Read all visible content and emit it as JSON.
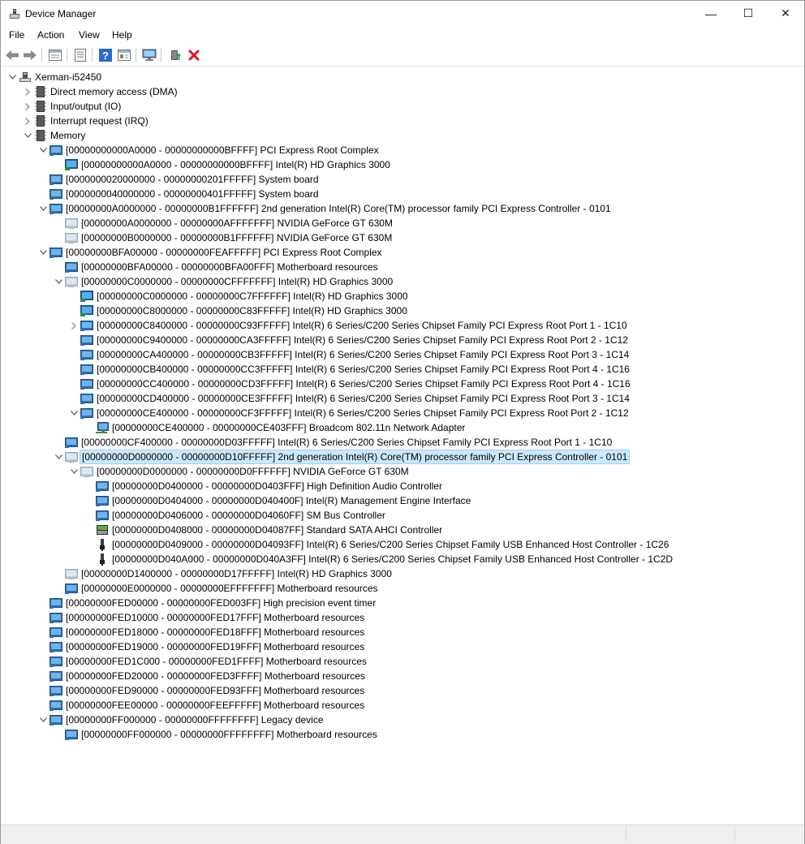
{
  "window": {
    "title": "Device Manager",
    "controls": {
      "minimize": "—",
      "maximize": "☐",
      "close": "✕"
    }
  },
  "menu": {
    "items": [
      "File",
      "Action",
      "View",
      "Help"
    ]
  },
  "toolbar": {
    "buttons": [
      "back-icon",
      "forward-icon",
      "properties-view-icon",
      "list-view-icon",
      "help-icon",
      "details-view-icon",
      "scan-hardware-icon",
      "update-driver-icon",
      "uninstall-icon"
    ]
  },
  "tree": {
    "rows": [
      {
        "depth": 0,
        "expander": "open",
        "icon": "computer-icon",
        "label": "Xerman-i52450"
      },
      {
        "depth": 1,
        "expander": "closed",
        "icon": "chip-icon",
        "label": "Direct memory access (DMA)"
      },
      {
        "depth": 1,
        "expander": "closed",
        "icon": "chip-icon",
        "label": "Input/output (IO)"
      },
      {
        "depth": 1,
        "expander": "closed",
        "icon": "chip-icon",
        "label": "Interrupt request (IRQ)"
      },
      {
        "depth": 1,
        "expander": "open",
        "icon": "chip-icon",
        "label": "Memory"
      },
      {
        "depth": 2,
        "expander": "open",
        "icon": "device-icon",
        "label": "[00000000000A0000 - 00000000000BFFFF]  PCI Express Root Complex"
      },
      {
        "depth": 3,
        "expander": "",
        "icon": "display-icon",
        "label": "[00000000000A0000 - 00000000000BFFFF]  Intel(R) HD Graphics 3000"
      },
      {
        "depth": 2,
        "expander": "",
        "icon": "device-icon",
        "label": "[0000000020000000 - 00000000201FFFFF]  System board"
      },
      {
        "depth": 2,
        "expander": "",
        "icon": "device-icon",
        "label": "[0000000040000000 - 00000000401FFFFF]  System board"
      },
      {
        "depth": 2,
        "expander": "open",
        "icon": "device-icon",
        "label": "[00000000A0000000 - 00000000B1FFFFFF]  2nd generation Intel(R) Core(TM) processor family PCI Express Controller - 0101"
      },
      {
        "depth": 3,
        "expander": "",
        "icon": "display-dim-icon",
        "label": "[00000000A0000000 - 00000000AFFFFFFF]  NVIDIA GeForce GT 630M"
      },
      {
        "depth": 3,
        "expander": "",
        "icon": "display-dim-icon",
        "label": "[00000000B0000000 - 00000000B1FFFFFF]  NVIDIA GeForce GT 630M"
      },
      {
        "depth": 2,
        "expander": "open",
        "icon": "device-icon",
        "label": "[00000000BFA00000 - 00000000FEAFFFFF]  PCI Express Root Complex"
      },
      {
        "depth": 3,
        "expander": "",
        "icon": "device-icon",
        "label": "[00000000BFA00000 - 00000000BFA00FFF]  Motherboard resources"
      },
      {
        "depth": 3,
        "expander": "open",
        "icon": "display-dim-icon",
        "label": "[00000000C0000000 - 00000000CFFFFFFF]  Intel(R) HD Graphics 3000"
      },
      {
        "depth": 4,
        "expander": "",
        "icon": "display-icon",
        "label": "[00000000C0000000 - 00000000C7FFFFFF]  Intel(R) HD Graphics 3000"
      },
      {
        "depth": 4,
        "expander": "",
        "icon": "display-icon",
        "label": "[00000000C8000000 - 00000000C83FFFFF]  Intel(R) HD Graphics 3000"
      },
      {
        "depth": 4,
        "expander": "closed",
        "icon": "device-icon",
        "label": "[00000000C8400000 - 00000000C93FFFFF]  Intel(R) 6 Series/C200 Series Chipset Family PCI Express Root Port 1 - 1C10"
      },
      {
        "depth": 4,
        "expander": "",
        "icon": "device-icon",
        "label": "[00000000C9400000 - 00000000CA3FFFFF]  Intel(R) 6 Series/C200 Series Chipset Family PCI Express Root Port 2 - 1C12"
      },
      {
        "depth": 4,
        "expander": "",
        "icon": "device-icon",
        "label": "[00000000CA400000 - 00000000CB3FFFFF]  Intel(R) 6 Series/C200 Series Chipset Family PCI Express Root Port 3 - 1C14"
      },
      {
        "depth": 4,
        "expander": "",
        "icon": "device-icon",
        "label": "[00000000CB400000 - 00000000CC3FFFFF]  Intel(R) 6 Series/C200 Series Chipset Family PCI Express Root Port 4 - 1C16"
      },
      {
        "depth": 4,
        "expander": "",
        "icon": "device-icon",
        "label": "[00000000CC400000 - 00000000CD3FFFFF]  Intel(R) 6 Series/C200 Series Chipset Family PCI Express Root Port 4 - 1C16"
      },
      {
        "depth": 4,
        "expander": "",
        "icon": "device-icon",
        "label": "[00000000CD400000 - 00000000CE3FFFFF]  Intel(R) 6 Series/C200 Series Chipset Family PCI Express Root Port 3 - 1C14"
      },
      {
        "depth": 4,
        "expander": "open",
        "icon": "device-icon",
        "label": "[00000000CE400000 - 00000000CF3FFFFF]  Intel(R) 6 Series/C200 Series Chipset Family PCI Express Root Port 2 - 1C12"
      },
      {
        "depth": 5,
        "expander": "",
        "icon": "network-icon",
        "label": "[00000000CE400000 - 00000000CE403FFF]  Broadcom 802.11n Network Adapter"
      },
      {
        "depth": 3,
        "expander": "",
        "icon": "device-icon",
        "label": "[00000000CF400000 - 00000000D03FFFFF]  Intel(R) 6 Series/C200 Series Chipset Family PCI Express Root Port 1 - 1C10"
      },
      {
        "depth": 3,
        "expander": "open",
        "icon": "display-dim-icon",
        "label": "[00000000D0000000 - 00000000D10FFFFF]  2nd generation Intel(R) Core(TM) processor family PCI Express Controller - 0101",
        "selected": true
      },
      {
        "depth": 4,
        "expander": "open",
        "icon": "display-dim-icon",
        "label": "[00000000D0000000 - 00000000D0FFFFFF]  NVIDIA GeForce GT 630M"
      },
      {
        "depth": 5,
        "expander": "",
        "icon": "device-icon",
        "label": "[00000000D0400000 - 00000000D0403FFF]  High Definition Audio Controller"
      },
      {
        "depth": 5,
        "expander": "",
        "icon": "device-icon",
        "label": "[00000000D0404000 - 00000000D040400F]  Intel(R) Management Engine Interface"
      },
      {
        "depth": 5,
        "expander": "",
        "icon": "device-icon",
        "label": "[00000000D0406000 - 00000000D04060FF]  SM Bus Controller"
      },
      {
        "depth": 5,
        "expander": "",
        "icon": "storage-icon",
        "label": "[00000000D0408000 - 00000000D04087FF]  Standard SATA AHCI Controller"
      },
      {
        "depth": 5,
        "expander": "",
        "icon": "usb-icon",
        "label": "[00000000D0409000 - 00000000D04093FF]  Intel(R) 6 Series/C200 Series Chipset Family USB Enhanced Host Controller - 1C26"
      },
      {
        "depth": 5,
        "expander": "",
        "icon": "usb-icon",
        "label": "[00000000D040A000 - 00000000D040A3FF]  Intel(R) 6 Series/C200 Series Chipset Family USB Enhanced Host Controller - 1C2D"
      },
      {
        "depth": 3,
        "expander": "",
        "icon": "display-dim-icon",
        "label": "[00000000D1400000 - 00000000D17FFFFF]  Intel(R) HD Graphics 3000"
      },
      {
        "depth": 3,
        "expander": "",
        "icon": "device-icon",
        "label": "[00000000E0000000 - 00000000EFFFFFFF]  Motherboard resources"
      },
      {
        "depth": 2,
        "expander": "",
        "icon": "device-icon",
        "label": "[00000000FED00000 - 00000000FED003FF]  High precision event timer"
      },
      {
        "depth": 2,
        "expander": "",
        "icon": "device-icon",
        "label": "[00000000FED10000 - 00000000FED17FFF]  Motherboard resources"
      },
      {
        "depth": 2,
        "expander": "",
        "icon": "device-icon",
        "label": "[00000000FED18000 - 00000000FED18FFF]  Motherboard resources"
      },
      {
        "depth": 2,
        "expander": "",
        "icon": "device-icon",
        "label": "[00000000FED19000 - 00000000FED19FFF]  Motherboard resources"
      },
      {
        "depth": 2,
        "expander": "",
        "icon": "device-icon",
        "label": "[00000000FED1C000 - 00000000FED1FFFF]  Motherboard resources"
      },
      {
        "depth": 2,
        "expander": "",
        "icon": "device-icon",
        "label": "[00000000FED20000 - 00000000FED3FFFF]  Motherboard resources"
      },
      {
        "depth": 2,
        "expander": "",
        "icon": "device-icon",
        "label": "[00000000FED90000 - 00000000FED93FFF]  Motherboard resources"
      },
      {
        "depth": 2,
        "expander": "",
        "icon": "device-icon",
        "label": "[00000000FEE00000 - 00000000FEEFFFFF]  Motherboard resources"
      },
      {
        "depth": 2,
        "expander": "open",
        "icon": "device-icon",
        "label": "[00000000FF000000 - 00000000FFFFFFFF]  Legacy device"
      },
      {
        "depth": 3,
        "expander": "",
        "icon": "device-icon",
        "label": "[00000000FF000000 - 00000000FFFFFFFF]  Motherboard resources"
      }
    ]
  },
  "colors": {
    "selection_bg": "#cce8ff",
    "selection_border": "#99d1ff",
    "uninstall": "#e81123",
    "help": "#2a6ac8"
  }
}
